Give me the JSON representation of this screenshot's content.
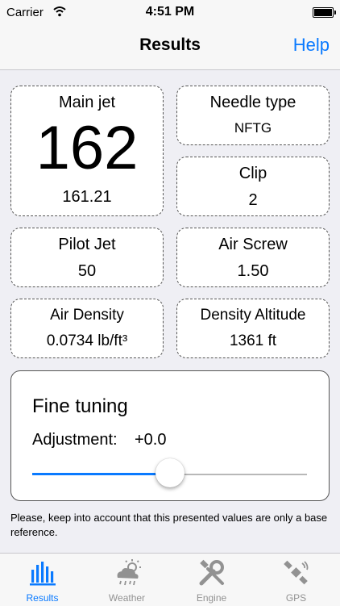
{
  "status": {
    "carrier": "Carrier",
    "time": "4:51 PM"
  },
  "nav": {
    "title": "Results",
    "help": "Help"
  },
  "cards": {
    "main_jet": {
      "label": "Main jet",
      "value": "162",
      "precise": "161.21"
    },
    "needle_type": {
      "label": "Needle type",
      "value": "NFTG"
    },
    "clip": {
      "label": "Clip",
      "value": "2"
    },
    "pilot_jet": {
      "label": "Pilot Jet",
      "value": "50"
    },
    "air_screw": {
      "label": "Air Screw",
      "value": "1.50"
    },
    "air_density": {
      "label": "Air Density",
      "value": "0.0734 lb/ft³"
    },
    "density_altitude": {
      "label": "Density Altitude",
      "value": "1361 ft"
    }
  },
  "fine_tuning": {
    "title": "Fine tuning",
    "adjustment_label": "Adjustment:",
    "adjustment_value": "+0.0",
    "slider_fraction": 0.5
  },
  "note": "Please, keep into account that this presented values are only a base reference.",
  "tabs": [
    {
      "label": "Results",
      "icon": "bar-chart-icon",
      "active": true
    },
    {
      "label": "Weather",
      "icon": "weather-icon",
      "active": false
    },
    {
      "label": "Engine",
      "icon": "tools-icon",
      "active": false
    },
    {
      "label": "GPS",
      "icon": "satellite-icon",
      "active": false
    }
  ],
  "colors": {
    "accent": "#0a7aff",
    "inactive": "#929292"
  }
}
